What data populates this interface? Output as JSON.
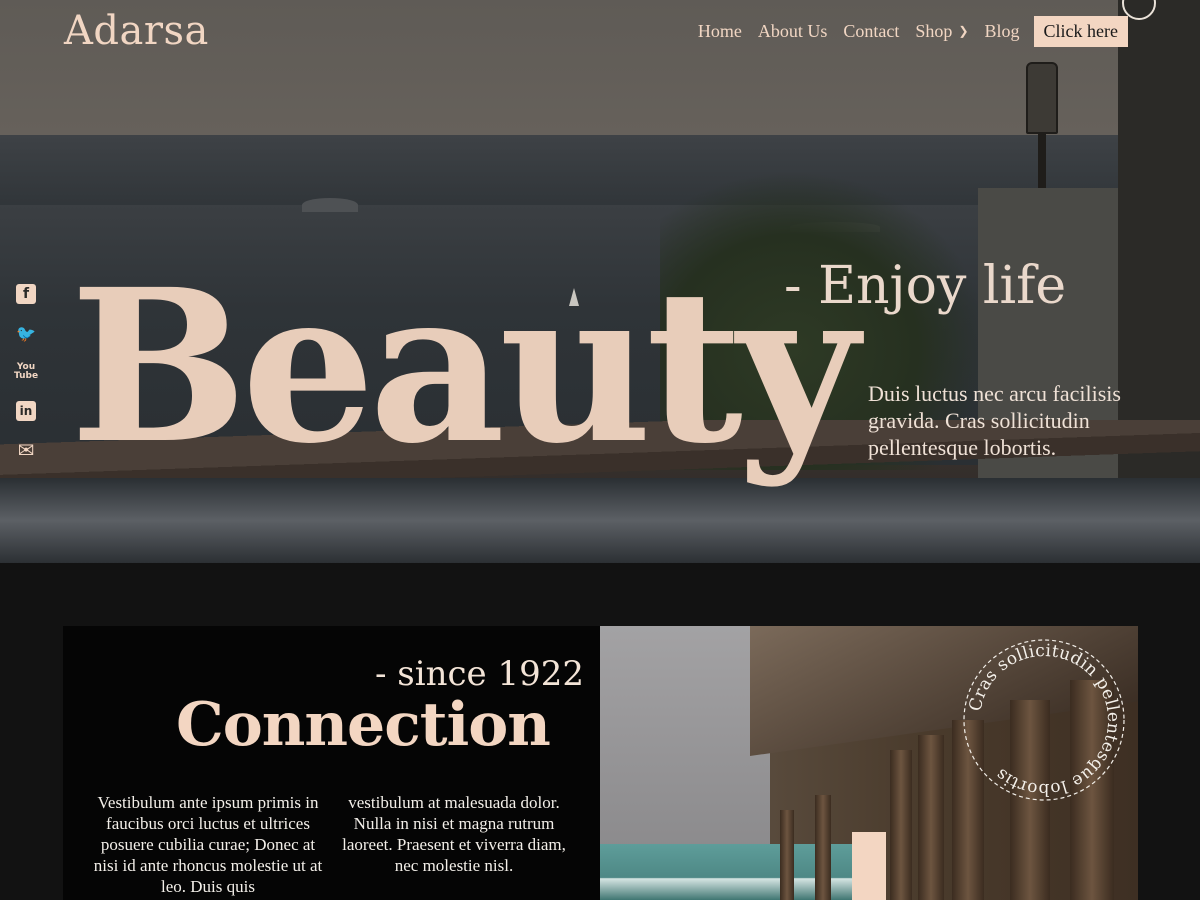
{
  "site": {
    "logo": "Adarsa"
  },
  "nav": {
    "items": [
      "Home",
      "About Us",
      "Contact",
      "Shop",
      "Blog"
    ],
    "cta_label": "Click here"
  },
  "social": [
    "facebook-icon",
    "twitter-icon",
    "youtube-icon",
    "linkedin-icon",
    "mail-icon"
  ],
  "social_glyphs": {
    "facebook": "f",
    "twitter": "🐦",
    "youtube_top": "You",
    "youtube_bottom": "Tube",
    "linkedin": "in",
    "mail": "✉"
  },
  "hero": {
    "title": "Beauty",
    "subtitle": "- Enjoy life",
    "text": "Duis luctus nec arcu facilisis gravida. Cras sollicitudin pellentesque lobortis."
  },
  "about": {
    "since": "- since 1922",
    "heading": "Connection",
    "col1": "Vestibulum ante ipsum primis in faucibus orci luctus et ultrices posuere cubilia curae; Donec at nisi id ante rhoncus molestie ut at leo. Duis quis",
    "col2": "vestibulum at malesuada dolor. Nulla in nisi et magna rutrum laoreet. Praesent et viverra diam, nec molestie nisl.",
    "stamp_text": "Cras sollicitudin pellentesque lobortis"
  },
  "colors": {
    "accent": "#f3d6c2",
    "background": "#121212",
    "panel": "#050505"
  }
}
